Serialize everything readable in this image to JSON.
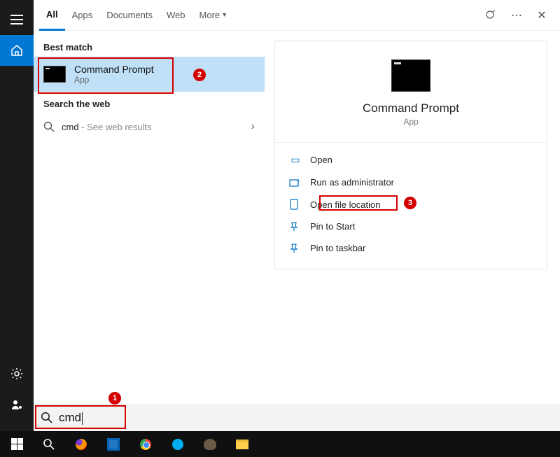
{
  "tabs": {
    "all": "All",
    "apps": "Apps",
    "documents": "Documents",
    "web": "Web",
    "more": "More"
  },
  "sections": {
    "best_match": "Best match",
    "search_web": "Search the web"
  },
  "best_result": {
    "title": "Command Prompt",
    "subtitle": "App"
  },
  "web_result": {
    "query": "cmd",
    "hint": " - See web results"
  },
  "preview": {
    "title": "Command Prompt",
    "subtitle": "App",
    "actions": {
      "open": "Open",
      "run_admin": "Run as administrator",
      "open_loc": "Open file location",
      "pin_start": "Pin to Start",
      "pin_taskbar": "Pin to taskbar"
    }
  },
  "searchbox": {
    "text": "cmd"
  },
  "callouts": {
    "c1": "1",
    "c2": "2",
    "c3": "3"
  },
  "top_icons": {
    "ellipsis": "⋯",
    "close": "✕"
  }
}
